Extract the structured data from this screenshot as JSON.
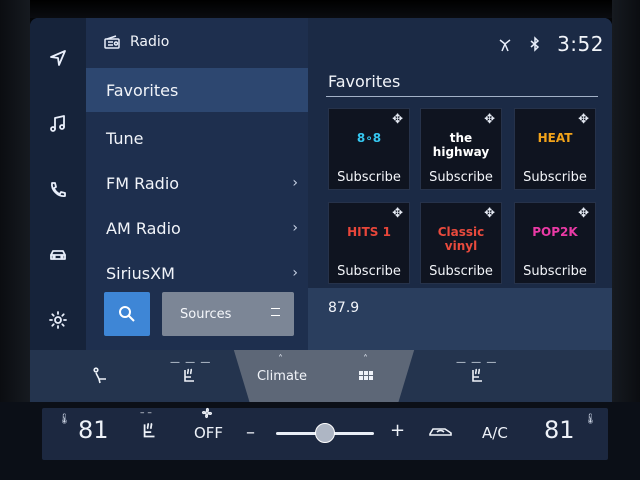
{
  "rail": {
    "items": [
      {
        "icon": "navigation-icon",
        "label": "Navigation"
      },
      {
        "icon": "music-icon",
        "label": "Audio"
      },
      {
        "icon": "phone-icon",
        "label": "Phone"
      },
      {
        "icon": "car-icon",
        "label": "Vehicle"
      },
      {
        "icon": "gear-icon",
        "label": "Settings"
      }
    ]
  },
  "menu": {
    "title": "Radio",
    "items": [
      {
        "label": "Favorites",
        "active": true,
        "chevron": ""
      },
      {
        "label": "Tune",
        "active": false,
        "chevron": ""
      },
      {
        "label": "FM Radio",
        "active": false,
        "chevron": "›"
      },
      {
        "label": "AM Radio",
        "active": false,
        "chevron": "›"
      },
      {
        "label": "SiriusXM",
        "active": false,
        "chevron": "›"
      }
    ],
    "sources_label": "Sources"
  },
  "status": {
    "time": "3:52"
  },
  "favorites": {
    "title": "Favorites",
    "tiles": [
      {
        "logo": "8∘8",
        "logo_color": "#35c7f0",
        "action": "Subscribe"
      },
      {
        "logo": "the highway",
        "logo_color": "#ffffff",
        "action": "Subscribe"
      },
      {
        "logo": "HEAT",
        "logo_color": "#f2a31a",
        "action": "Subscribe"
      },
      {
        "logo": "HITS 1",
        "logo_color": "#e8463a",
        "action": "Subscribe"
      },
      {
        "logo": "Classic vinyl",
        "logo_color": "#e94a3d",
        "action": "Subscribe"
      },
      {
        "logo": "POP2K",
        "logo_color": "#ea3aa5",
        "action": "Subscribe"
      }
    ],
    "plus_glyph": "✥"
  },
  "now_playing": {
    "frequency": "87.9"
  },
  "shortcuts": {
    "climate_label": "Climate",
    "caret": "˄",
    "dashes": "— — —"
  },
  "climate": {
    "left_temp": "81",
    "right_temp": "81",
    "fan_state": "OFF",
    "ac_label": "A/C",
    "minus": "–",
    "plus": "+",
    "seat_dashes": "– –",
    "thermometer": "🌡",
    "fan_level": 0.5
  },
  "colors": {
    "accent_blue": "#3e86d6",
    "screen_bg": "#1b2a44",
    "active_item": "#2d4770"
  }
}
